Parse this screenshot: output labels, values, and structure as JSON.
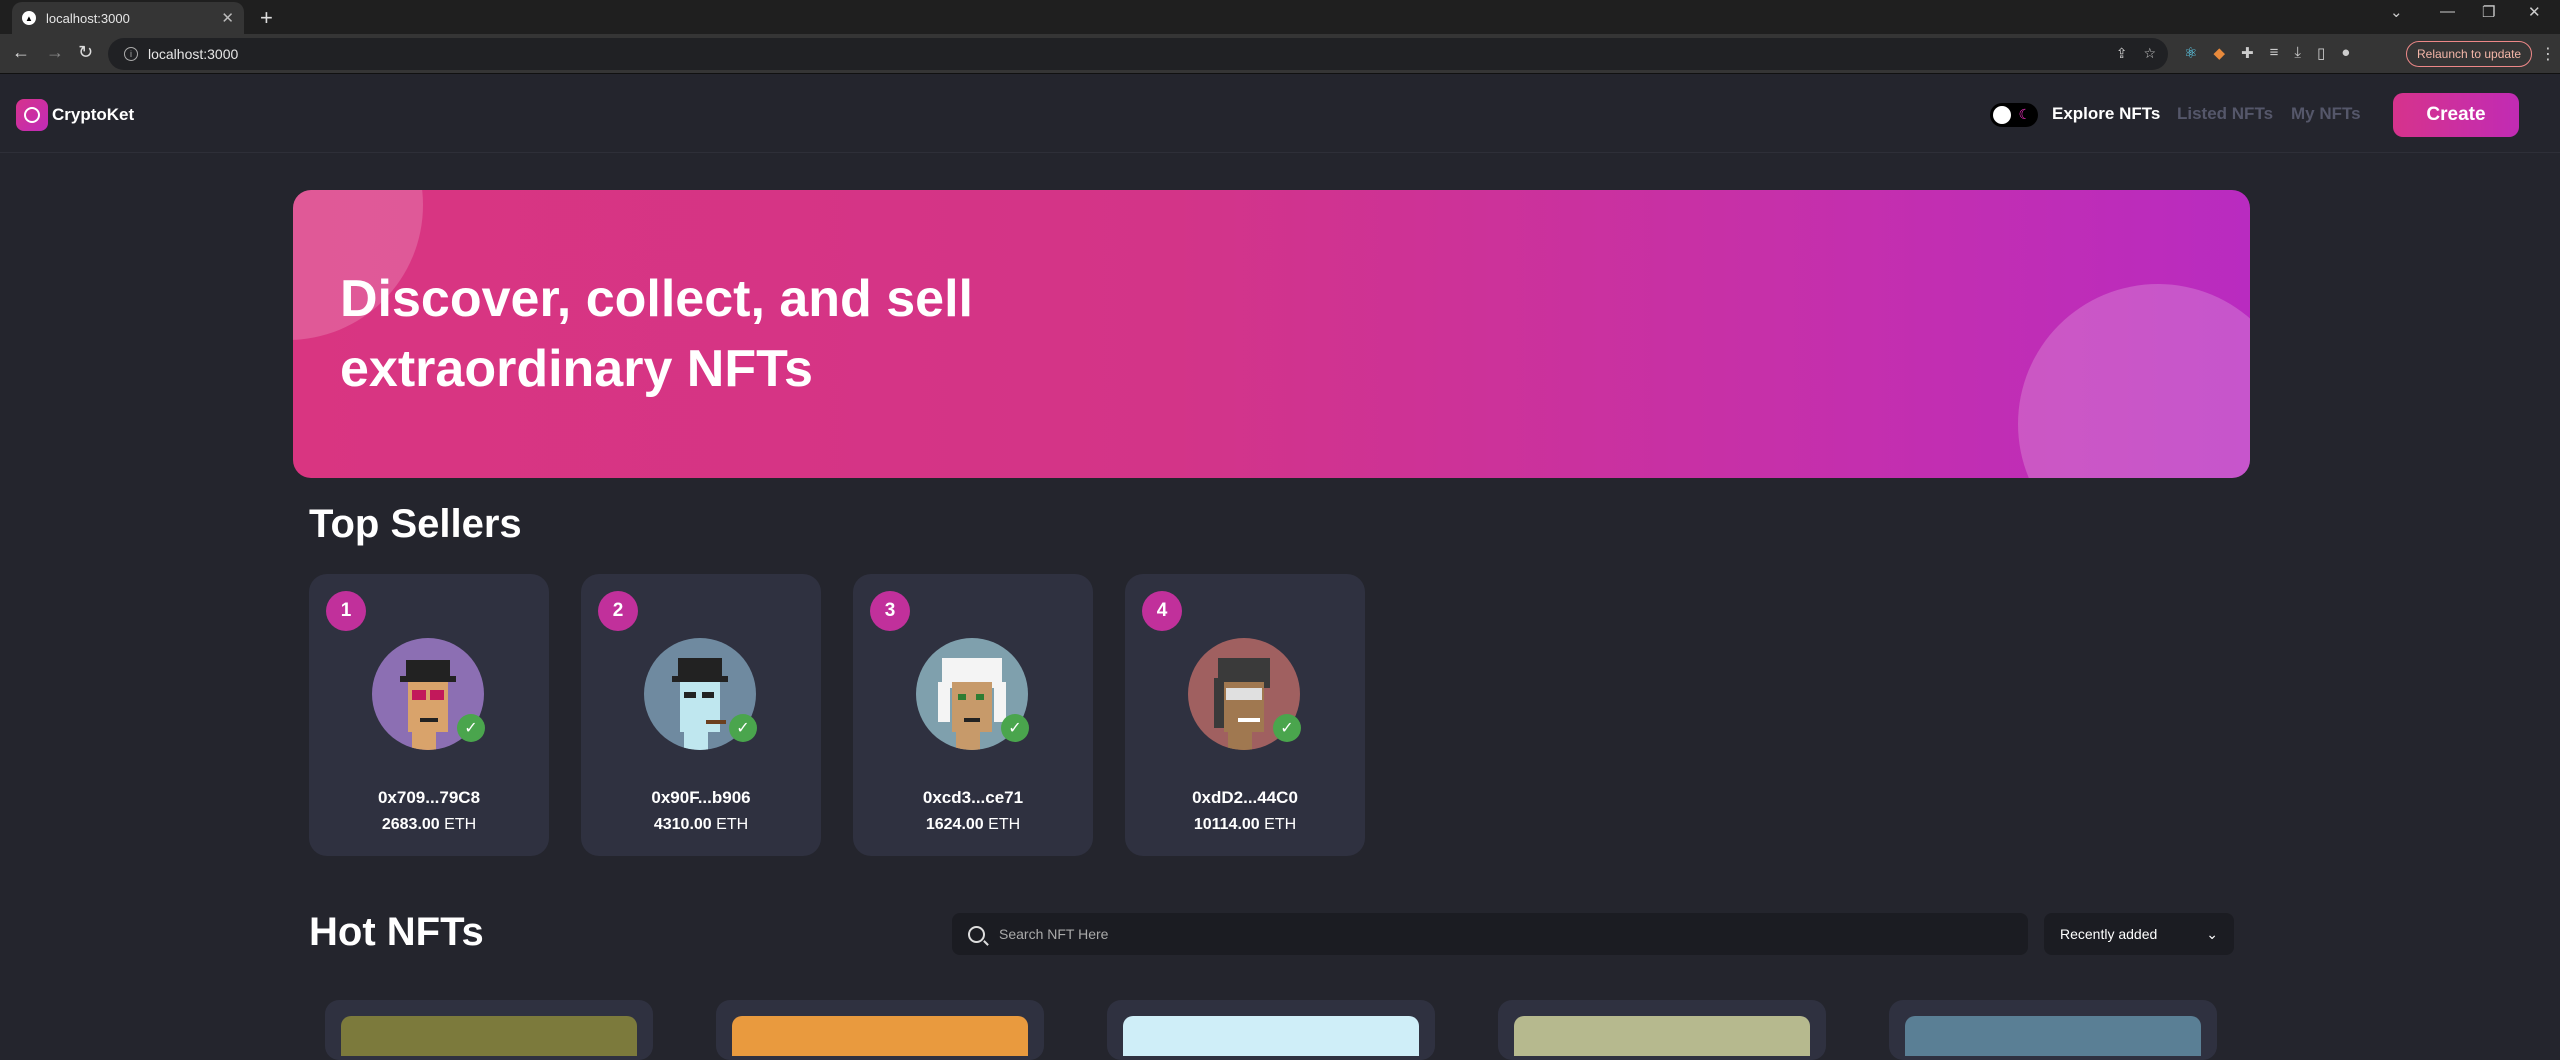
{
  "browser": {
    "tab_title": "localhost:3000",
    "new_tab": "+",
    "url": "localhost:3000",
    "relaunch_label": "Relaunch to update"
  },
  "navbar": {
    "brand": "CryptoKet",
    "links": [
      {
        "label": "Explore NFTs",
        "active": true
      },
      {
        "label": "Listed NFTs",
        "active": false
      },
      {
        "label": "My NFTs",
        "active": false
      }
    ],
    "create_label": "Create"
  },
  "hero": {
    "title": "Discover, collect, and sell extraordinary NFTs"
  },
  "top_sellers": {
    "title": "Top Sellers",
    "items": [
      {
        "rank": "1",
        "address": "0x709...79C8",
        "amount": "2683.00",
        "unit": "ETH",
        "avatar_bg": "#8c6fb3"
      },
      {
        "rank": "2",
        "address": "0x90F...b906",
        "amount": "4310.00",
        "unit": "ETH",
        "avatar_bg": "#6f8aa0"
      },
      {
        "rank": "3",
        "address": "0xcd3...ce71",
        "amount": "1624.00",
        "unit": "ETH",
        "avatar_bg": "#7fa0ad"
      },
      {
        "rank": "4",
        "address": "0xdD2...44C0",
        "amount": "10114.00",
        "unit": "ETH",
        "avatar_bg": "#a06060"
      }
    ]
  },
  "hot_nfts": {
    "title": "Hot NFTs",
    "search_placeholder": "Search NFT Here",
    "sort_value": "Recently added",
    "card_colors": [
      "#7c7a3c",
      "#e99a3e",
      "#cfeef8",
      "#b6b98e",
      "#5a7f95"
    ]
  },
  "colors": {
    "accent": "#d6338c",
    "background": "#24252d",
    "card": "#2f3140"
  }
}
